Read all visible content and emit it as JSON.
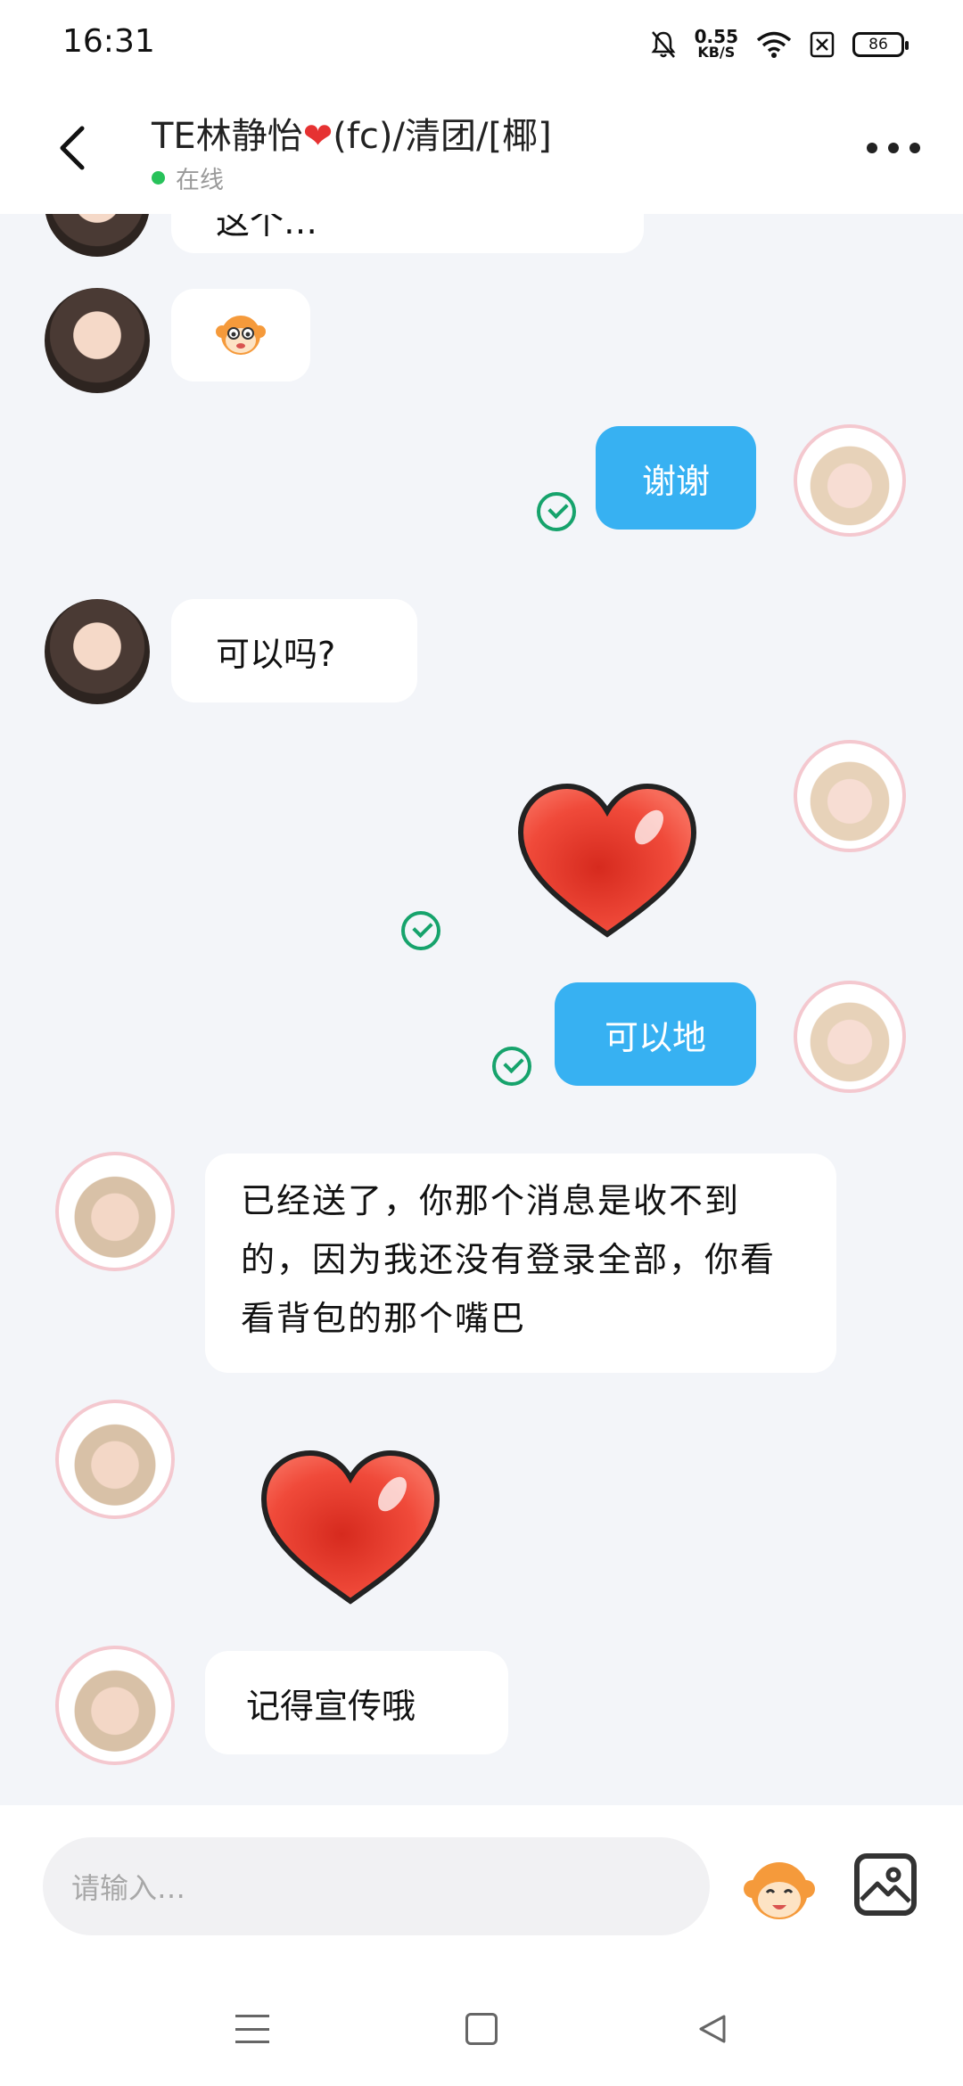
{
  "status_bar": {
    "time": "16:31",
    "net_speed_value": "0.55",
    "net_speed_unit": "KB/S",
    "battery": "86"
  },
  "header": {
    "title_before_heart": "TE林静怡",
    "title_after_heart": "(fc)/清团/[椰]",
    "status": "在线"
  },
  "messages": [
    {
      "from": "them",
      "text": "这个…"
    },
    {
      "from": "them",
      "type": "sticker",
      "icon": "monkey-emoji-icon"
    },
    {
      "from": "me",
      "text": "谢谢",
      "read": true
    },
    {
      "from": "them",
      "text": "可以吗?"
    },
    {
      "from": "me",
      "type": "sticker",
      "icon": "heart-icon",
      "read": true
    },
    {
      "from": "me",
      "text": "可以地",
      "read": true
    },
    {
      "from": "them",
      "text": "已经送了，你那个消息是收不到的，因为我还没有登录全部，你看看背包的那个嘴巴"
    },
    {
      "from": "them",
      "type": "sticker",
      "icon": "heart-icon"
    },
    {
      "from": "them",
      "text": "记得宣传哦"
    }
  ],
  "input": {
    "placeholder": "请输入…"
  },
  "colors": {
    "my_bubble": "#37b1f2",
    "read_check": "#16a36c",
    "online_dot": "#27c25a",
    "heart": "#e63232"
  }
}
